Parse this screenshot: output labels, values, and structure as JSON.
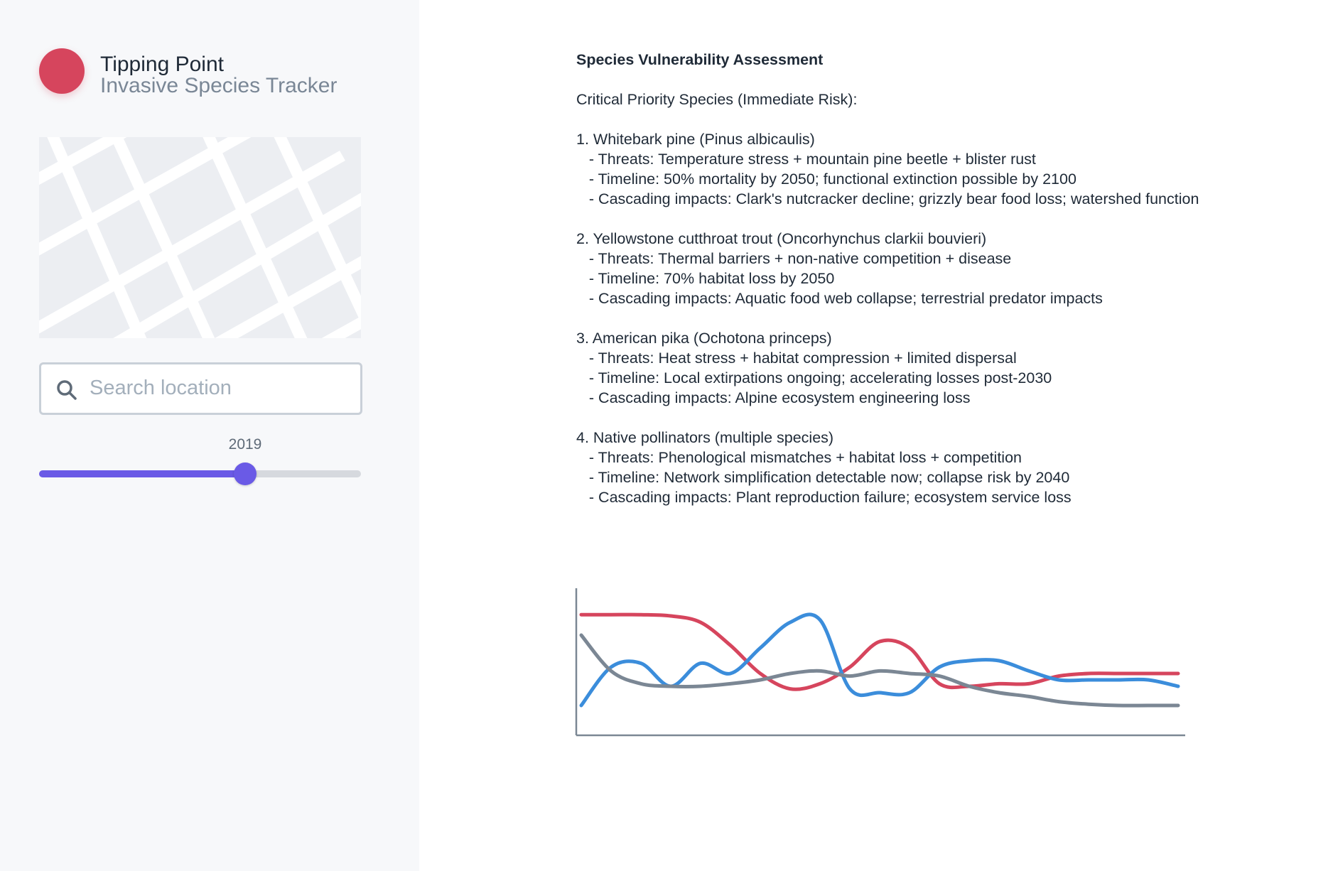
{
  "app": {
    "title": "Tipping Point",
    "subtitle": "Invasive Species Tracker",
    "brand_color": "#d6455d"
  },
  "sidebar": {
    "search": {
      "placeholder": "Search location",
      "value": "",
      "icon": "search-icon"
    },
    "timeline": {
      "year": "2019",
      "progress": 0.64,
      "accent": "#6a5ae6"
    }
  },
  "report": {
    "title": "Species Vulnerability Assessment",
    "intro": "Critical Priority Species (Immediate Risk):",
    "species": [
      {
        "heading": "1. Whitebark pine (Pinus albicaulis)",
        "threats": "   - Threats: Temperature stress + mountain pine beetle + blister rust",
        "timeline": "   - Timeline: 50% mortality by 2050; functional extinction possible by 2100",
        "impacts": "   - Cascading impacts: Clark's nutcracker decline; grizzly bear food loss; watershed function"
      },
      {
        "heading": "2. Yellowstone cutthroat trout (Oncorhynchus clarkii bouvieri)",
        "threats": "   - Threats: Thermal barriers + non-native competition + disease",
        "timeline": "   - Timeline: 70% habitat loss by 2050",
        "impacts": "   - Cascading impacts: Aquatic food web collapse; terrestrial predator impacts"
      },
      {
        "heading": "3. American pika (Ochotona princeps)",
        "threats": "   - Threats: Heat stress + habitat compression + limited dispersal",
        "timeline": "   - Timeline: Local extirpations ongoing; accelerating losses post-2030",
        "impacts": "   - Cascading impacts: Alpine ecosystem engineering loss"
      },
      {
        "heading": "4. Native pollinators (multiple species)",
        "threats": "   - Threats: Phenological mismatches + habitat loss + competition",
        "timeline": "   - Timeline: Network simplification detectable now; collapse risk by 2040",
        "impacts": "   - Cascading impacts: Plant reproduction failure; ecosystem service loss"
      }
    ]
  },
  "chart_data": {
    "type": "line",
    "title": "",
    "xlabel": "",
    "ylabel": "",
    "xlim": [
      0,
      100
    ],
    "ylim": [
      0,
      100
    ],
    "grid": false,
    "x": [
      0,
      5,
      10,
      15,
      20,
      25,
      30,
      35,
      40,
      45,
      50,
      55,
      60,
      65,
      70,
      75,
      80,
      85,
      90,
      95,
      100
    ],
    "series": [
      {
        "color": "#d6455d",
        "values": [
          86,
          86,
          86,
          85,
          80,
          62,
          40,
          28,
          32,
          45,
          65,
          60,
          32,
          30,
          32,
          32,
          38,
          40,
          40,
          40,
          40
        ]
      },
      {
        "color": "#3b8ddb",
        "values": [
          15,
          45,
          48,
          30,
          48,
          40,
          60,
          80,
          82,
          28,
          25,
          25,
          45,
          50,
          50,
          42,
          35,
          35,
          35,
          35,
          30
        ]
      },
      {
        "color": "#7b8794",
        "values": [
          70,
          42,
          32,
          30,
          30,
          32,
          35,
          40,
          42,
          38,
          42,
          40,
          38,
          30,
          25,
          22,
          18,
          16,
          15,
          15,
          15
        ]
      }
    ]
  }
}
